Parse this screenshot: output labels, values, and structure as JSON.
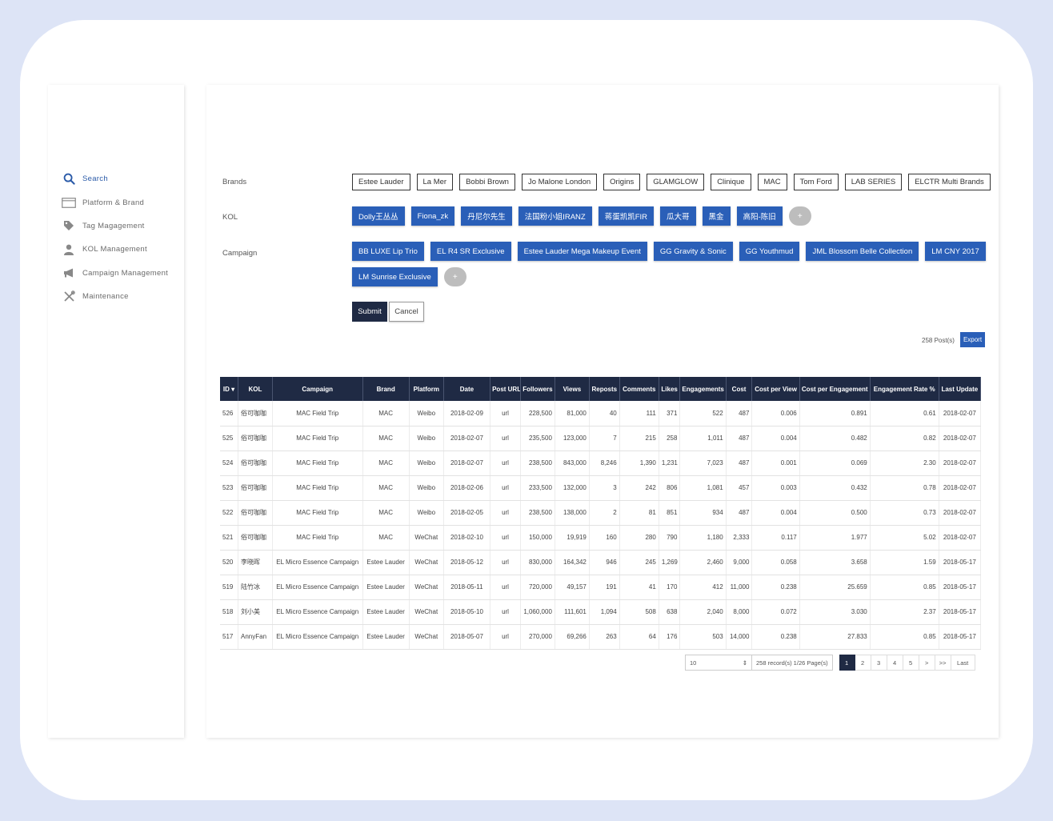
{
  "sidebar": {
    "items": [
      {
        "label": "Search",
        "icon": "search-icon"
      },
      {
        "label": "Platform & Brand",
        "icon": "window-icon"
      },
      {
        "label": "Tag Magagement",
        "icon": "tag-icon"
      },
      {
        "label": "KOL Management",
        "icon": "user-icon"
      },
      {
        "label": "Campaign Management",
        "icon": "megaphone-icon"
      },
      {
        "label": "Maintenance",
        "icon": "tools-icon"
      }
    ]
  },
  "filters": {
    "brands_label": "Brands",
    "kol_label": "KOL",
    "campaign_label": "Campaign",
    "brands": [
      "Estee Lauder",
      "La Mer",
      "Bobbi Brown",
      "Jo Malone London",
      "Origins",
      "GLAMGLOW",
      "Clinique",
      "MAC",
      "Tom Ford",
      "LAB SERIES",
      "ELCTR Multi Brands"
    ],
    "kols": [
      "Dolly王丛丛",
      "Fiona_zk",
      "丹尼尔先生",
      "法国粉小姐IRANZ",
      "蒋蛋凯凯FIR",
      "瓜大哥",
      "黑金",
      "高阳-陈旧"
    ],
    "kol_more": "+",
    "campaigns": [
      "BB LUXE Lip Trio",
      "EL R4 SR Exclusive",
      "Estee Lauder Mega Makeup Event",
      "GG Gravity & Sonic",
      "GG Youthmud",
      "JML Blossom Belle Collection",
      "LM CNY 2017",
      "LM Sunrise Exclusive"
    ],
    "campaign_more": "+",
    "submit_label": "Submit",
    "cancel_label": "Cancel"
  },
  "results": {
    "posts_label": "258 Post(s)",
    "export_label": "Export"
  },
  "table": {
    "headers": [
      "ID ▾",
      "KOL",
      "Campaign",
      "Brand",
      "Platform",
      "Date",
      "Post URL",
      "Followers",
      "Views",
      "Reposts",
      "Comments",
      "Likes",
      "Engagements",
      "Cost",
      "Cost per View",
      "Cost per Engagement",
      "Engagement Rate %",
      "Last Update"
    ],
    "rows": [
      [
        "526",
        "俗可咖咖",
        "MAC Field Trip",
        "MAC",
        "Weibo",
        "2018-02-09",
        "url",
        "228,500",
        "81,000",
        "40",
        "111",
        "371",
        "522",
        "487",
        "0.006",
        "0.891",
        "0.61",
        "2018-02-07"
      ],
      [
        "525",
        "俗可咖咖",
        "MAC Field Trip",
        "MAC",
        "Weibo",
        "2018-02-07",
        "url",
        "235,500",
        "123,000",
        "7",
        "215",
        "258",
        "1,011",
        "487",
        "0.004",
        "0.482",
        "0.82",
        "2018-02-07"
      ],
      [
        "524",
        "俗可咖咖",
        "MAC Field Trip",
        "MAC",
        "Weibo",
        "2018-02-07",
        "url",
        "238,500",
        "843,000",
        "8,246",
        "1,390",
        "1,231",
        "7,023",
        "487",
        "0.001",
        "0.069",
        "2.30",
        "2018-02-07"
      ],
      [
        "523",
        "俗可咖咖",
        "MAC Field Trip",
        "MAC",
        "Weibo",
        "2018-02-06",
        "url",
        "233,500",
        "132,000",
        "3",
        "242",
        "806",
        "1,081",
        "457",
        "0.003",
        "0.432",
        "0.78",
        "2018-02-07"
      ],
      [
        "522",
        "俗可咖咖",
        "MAC Field Trip",
        "MAC",
        "Weibo",
        "2018-02-05",
        "url",
        "238,500",
        "138,000",
        "2",
        "81",
        "851",
        "934",
        "487",
        "0.004",
        "0.500",
        "0.73",
        "2018-02-07"
      ],
      [
        "521",
        "俗可咖咖",
        "MAC Field Trip",
        "MAC",
        "WeChat",
        "2018-02-10",
        "url",
        "150,000",
        "19,919",
        "160",
        "280",
        "790",
        "1,180",
        "2,333",
        "0.117",
        "1.977",
        "5.02",
        "2018-02-07"
      ],
      [
        "520",
        "李晓晖",
        "EL Micro Essence Campaign",
        "Estee Lauder",
        "WeChat",
        "2018-05-12",
        "url",
        "830,000",
        "164,342",
        "946",
        "245",
        "1,269",
        "2,460",
        "9,000",
        "0.058",
        "3.658",
        "1.59",
        "2018-05-17"
      ],
      [
        "519",
        "陆竹冰",
        "EL Micro Essence Campaign",
        "Estee Lauder",
        "WeChat",
        "2018-05-11",
        "url",
        "720,000",
        "49,157",
        "191",
        "41",
        "170",
        "412",
        "11,000",
        "0.238",
        "25.659",
        "0.85",
        "2018-05-17"
      ],
      [
        "518",
        "刘小美",
        "EL Micro Essence Campaign",
        "Estee Lauder",
        "WeChat",
        "2018-05-10",
        "url",
        "1,060,000",
        "111,601",
        "1,094",
        "508",
        "638",
        "2,040",
        "8,000",
        "0.072",
        "3.030",
        "2.37",
        "2018-05-17"
      ],
      [
        "517",
        "AnnyFan",
        "EL Micro Essence Campaign",
        "Estee Lauder",
        "WeChat",
        "2018-05-07",
        "url",
        "270,000",
        "69,266",
        "263",
        "64",
        "176",
        "503",
        "14,000",
        "0.238",
        "27.833",
        "0.85",
        "2018-05-17"
      ]
    ]
  },
  "pager": {
    "page_size": "10",
    "page_size_arrow": "⇕",
    "info": "258 record(s) 1/26 Page(s)",
    "pages": [
      "1",
      "2",
      "3",
      "4",
      "5",
      ">",
      ">>",
      "Last"
    ]
  }
}
